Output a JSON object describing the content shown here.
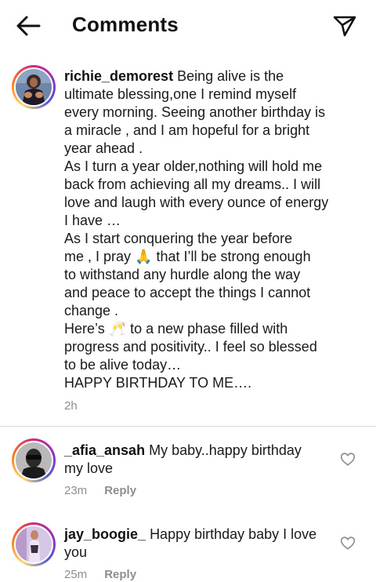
{
  "header": {
    "title": "Comments",
    "back_icon": "arrow-left-icon",
    "send_icon": "paper-plane-icon"
  },
  "caption": {
    "username": "richie_demorest",
    "lines": [
      "Being alive is the",
      "ultimate blessing,one I remind myself",
      "every morning. Seeing another birthday is",
      "a miracle , and I am hopeful for a bright",
      "year ahead .",
      "As I turn a year older,nothing will hold me",
      "back from achieving all my dreams.. I will",
      "love and laugh with every ounce of energy",
      "I have …",
      "As I start conquering the year before",
      "me , I pray 🙏 that I’ll be strong enough",
      "to withstand any hurdle along the way",
      "and peace to accept the things I cannot",
      "change .",
      "Here’s 🥂 to a new phase filled with",
      "progress and positivity.. I feel so blessed",
      "to be alive today…",
      "HAPPY BIRTHDAY TO ME…."
    ],
    "time": "2h"
  },
  "comments": [
    {
      "username": "_afia_ansah",
      "line1": "My baby..happy birthday",
      "line2": "my love",
      "time": "23m",
      "reply_label": "Reply"
    },
    {
      "username": "jay_boogie_",
      "line1": "Happy birthday baby I love",
      "line2": "you",
      "time": "25m",
      "reply_label": "Reply"
    }
  ],
  "colors": {
    "meta_gray": "#8e8e8e",
    "divider": "#dbdbdb",
    "story_ring_start": "#feda75",
    "story_ring_mid": "#d62976",
    "story_ring_end": "#4f5bd5"
  }
}
